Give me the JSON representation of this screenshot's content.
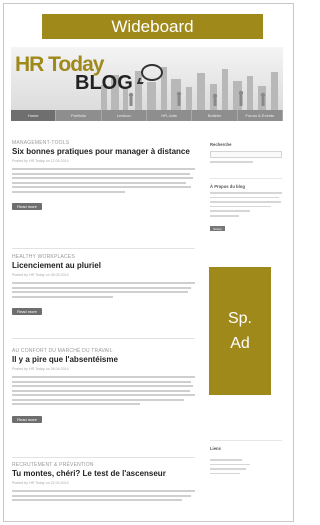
{
  "ads": {
    "top": "Wideboard",
    "side_line1": "Sp.",
    "side_line2": "Ad"
  },
  "logo": {
    "part1": "HR Today",
    "part2": "BLOG"
  },
  "nav": [
    "Home",
    "Portfolio",
    "Lexikon",
    "HR-Jobs",
    "Bulletin",
    "Forum & Events"
  ],
  "posts": [
    {
      "category": "Management-Tools",
      "title": "Six bonnes pratiques pour manager à distance",
      "meta": "Posted by HR Today on 12.05.2014",
      "button": "Read more"
    },
    {
      "category": "Healthy Workplaces",
      "title": "Licenciement au pluriel",
      "meta": "Posted by HR Today on 05.05.2014",
      "button": "Read more"
    },
    {
      "category": "Au confort du marché du travail",
      "title": "Il y a pire que l'absentéisme",
      "meta": "Posted by HR Today on 28.04.2014",
      "button": "Read more"
    },
    {
      "category": "Recrutement & Prévention",
      "title": "Tu montes, chéri? Le test de l'ascenseur",
      "meta": "Posted by HR Today on 22.04.2014"
    }
  ],
  "sidebar": {
    "search_title": "Recherche",
    "about_title": "À Propos du blog",
    "about_button": "Suivre",
    "links_title": "Liens"
  },
  "colors": {
    "accent": "#a0891b",
    "nav": "#8e8e8e",
    "button": "#6e6e6e"
  }
}
